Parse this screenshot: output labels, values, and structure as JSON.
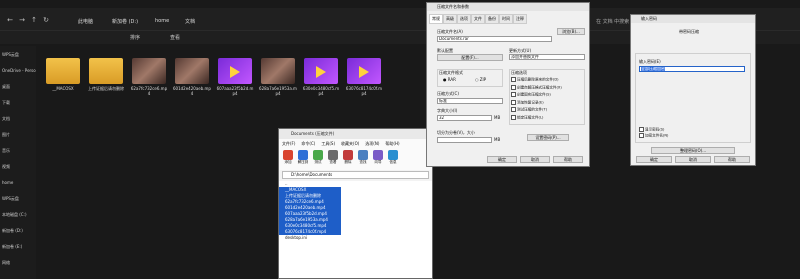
{
  "explorer": {
    "breadcrumb": [
      "此电脑",
      "新加卷 (D:)",
      "home",
      "文档"
    ],
    "search_placeholder": "在 文档 中搜索",
    "toolbar": {
      "sort": "排序",
      "view": "查看"
    },
    "sidebar": [
      "WPS云盘",
      "OneDrive - Perso",
      "桌面",
      "下载",
      "文档",
      "图片",
      "音乐",
      "视频",
      "home",
      "WPS云盘",
      "本地磁盘 (C:)",
      "新加卷 (D:)",
      "新加卷 (E:)",
      "网络"
    ],
    "files": [
      {
        "name": "__MACOSX",
        "kind": "folder"
      },
      {
        "name": "上传证据后请勿删除",
        "kind": "folder"
      },
      {
        "name": "62a7fc732ce6.mp4",
        "kind": "photo"
      },
      {
        "name": "601d2e420aeb.mp4",
        "kind": "photo"
      },
      {
        "name": "607aaa23f5b2d.mp4",
        "kind": "video"
      },
      {
        "name": "628a7a6e1953a.mp4",
        "kind": "photo"
      },
      {
        "name": "630e0c3480cf5.mp4",
        "kind": "video"
      },
      {
        "name": "63076c8174c0f.mp4",
        "kind": "video"
      }
    ]
  },
  "winrar": {
    "title": "Documents (压缩文件)",
    "menu": [
      "文件(F)",
      "命令(C)",
      "工具(S)",
      "收藏夹(O)",
      "选项(N)",
      "帮助(H)"
    ],
    "tools": [
      {
        "label": "添加",
        "color": "#d9442e"
      },
      {
        "label": "解压到",
        "color": "#2f6fd6"
      },
      {
        "label": "测试",
        "color": "#4aa84a"
      },
      {
        "label": "查看",
        "color": "#6b6b6b"
      },
      {
        "label": "删除",
        "color": "#c23b3b"
      },
      {
        "label": "查找",
        "color": "#4a7fc0"
      },
      {
        "label": "向导",
        "color": "#7a5bc7"
      },
      {
        "label": "信息",
        "color": "#2a8fd0"
      }
    ],
    "path": "D:\\home\\Documents",
    "rows": [
      {
        "name": "..",
        "sel": false
      },
      {
        "name": "__MACOSX",
        "sel": true
      },
      {
        "name": "上传证据后请勿删除",
        "sel": true
      },
      {
        "name": "62a7fc732ce6.mp4",
        "sel": true
      },
      {
        "name": "601d2e420aeb.mp4",
        "sel": true
      },
      {
        "name": "607aaa23f5b2d.mp4",
        "sel": true
      },
      {
        "name": "628a7a6e1953a.mp4",
        "sel": true
      },
      {
        "name": "630e0c3480cf5.mp4",
        "sel": true
      },
      {
        "name": "63076c8174c0f.mp4",
        "sel": true
      },
      {
        "name": "desktop.ini",
        "sel": false
      }
    ]
  },
  "archive_dialog": {
    "title": "压缩文件名和参数",
    "tabs": [
      "常规",
      "高级",
      "选项",
      "文件",
      "备份",
      "时间",
      "注释"
    ],
    "archive_name_label": "压缩文件名(A)",
    "archive_name": "Documents.rar",
    "browse": "浏览(B)...",
    "default_profile_label": "默认配置",
    "profiles_button": "配置(F)...",
    "update_mode_label": "更新方式(U)",
    "update_mode": "添加并替换文件",
    "format_label": "压缩文件格式",
    "format_rar": "RAR",
    "format_zip": "ZIP",
    "method_label": "压缩方式(C)",
    "method": "标准",
    "dict_label": "字典大小(I)",
    "dict": "32",
    "dict_unit": "MB",
    "split_label": "切分为分卷(V)，大小",
    "split_unit": "MB",
    "options_label": "压缩选项",
    "options": [
      "压缩后删除原来的文件(D)",
      "创建自解压格式压缩文件(X)",
      "创建固实压缩文件(S)",
      "添加恢复记录(E)",
      "测试压缩的文件(T)",
      "锁定压缩文件(L)"
    ],
    "password_button": "设置密码(P)...",
    "ok": "确定",
    "cancel": "取消",
    "help": "帮助"
  },
  "password_dialog": {
    "title": "输入密码",
    "heading": "带密码压缩",
    "field_label": "输入密码(E)",
    "field_value": "全部压缩加密",
    "show_password": "显示密码(S)",
    "encrypt_names": "加密文件名(N)",
    "manage": "整理密码(O)...",
    "ok": "确定",
    "cancel": "取消",
    "help": "帮助"
  }
}
